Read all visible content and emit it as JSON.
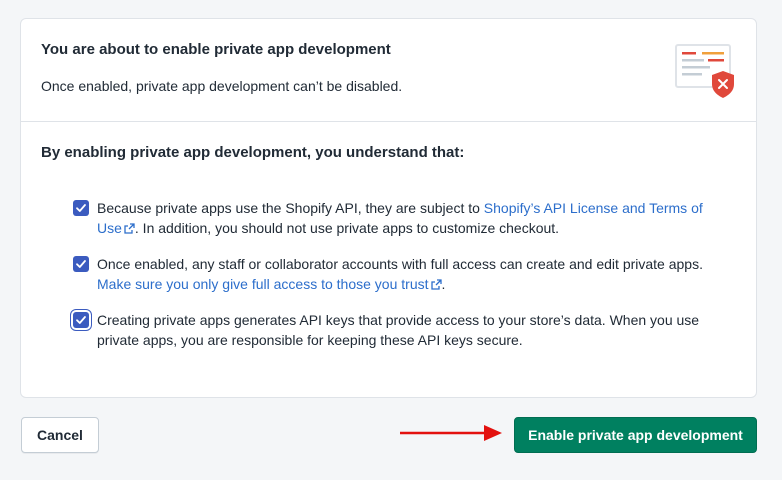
{
  "header": {
    "title": "You are about to enable private app development",
    "subtitle": "Once enabled, private app development can’t be disabled."
  },
  "section": {
    "title": "By enabling private app development, you understand that:"
  },
  "items": [
    {
      "checked": true,
      "text_before": "Because private apps use the Shopify API, they are subject to ",
      "link": "Shopify’s API License and Terms of Use",
      "text_after": ". In addition, you should not use private apps to customize checkout."
    },
    {
      "checked": true,
      "text_before": "Once enabled, any staff or collaborator accounts with full access can create and edit private apps. ",
      "link": "Make sure you only give full access to those you trust",
      "text_after": "."
    },
    {
      "checked": true,
      "text_before": "Creating private apps generates API keys that provide access to your store’s data. When you use private apps, you are responsible for keeping these API keys secure.",
      "link": "",
      "text_after": ""
    }
  ],
  "footer": {
    "cancel_label": "Cancel",
    "primary_label": "Enable private app development"
  },
  "icons": {
    "illustration": "document-shield-icon",
    "external_link": "external-link-icon",
    "checkmark": "checkmark-icon",
    "annotation_arrow": "red-arrow-icon"
  },
  "colors": {
    "primary": "#008060",
    "link": "#2c6ecb",
    "checkbox": "#3b5bbf",
    "arrow": "#e3110f",
    "danger": "#e0483b"
  }
}
